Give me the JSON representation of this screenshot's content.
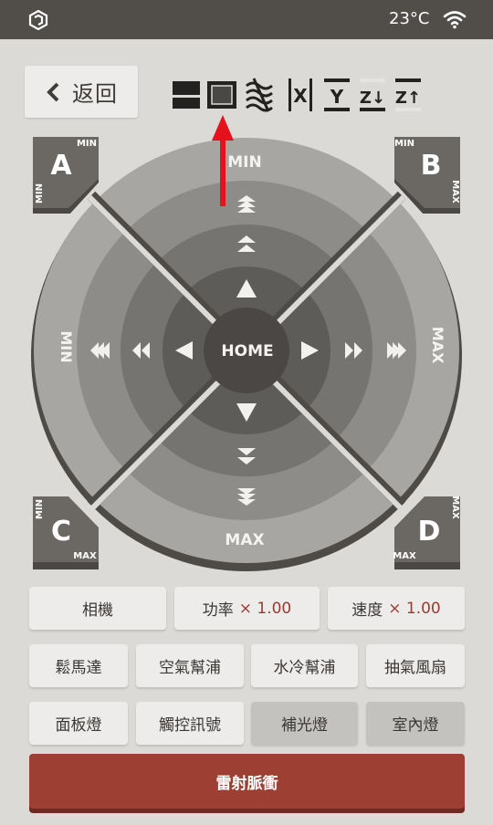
{
  "status_bar": {
    "temperature": "23°C",
    "logo_icon": "app-logo-icon",
    "wifi_icon": "wifi-icon"
  },
  "back_button": {
    "label": "返回",
    "icon": "chevron-left-icon"
  },
  "mode_icons": [
    {
      "name": "mode-fill-icon"
    },
    {
      "name": "mode-frame-icon",
      "selected": true
    },
    {
      "name": "mode-wave-icon"
    },
    {
      "name": "axis-x-icon",
      "label": "X"
    },
    {
      "name": "axis-y-icon",
      "label": "Y"
    },
    {
      "name": "axis-z-down-icon",
      "label": "Z↓"
    },
    {
      "name": "axis-z-up-icon",
      "label": "Z↑"
    }
  ],
  "jog_pad": {
    "home_label": "HOME",
    "top_label": "MIN",
    "bottom_label": "MAX",
    "left_label": "MIN",
    "right_label": "MAX"
  },
  "corners": {
    "a": {
      "label": "A",
      "min": "MIN",
      "max": "MIN"
    },
    "b": {
      "label": "B",
      "min": "MIN",
      "max": "MAX"
    },
    "c": {
      "label": "C",
      "min": "MIN",
      "max": "MAX"
    },
    "d": {
      "label": "D",
      "min": "MAX",
      "max": "MAX"
    }
  },
  "row1": {
    "camera": "相機",
    "power_label": "功率",
    "power_value": "× 1.00",
    "speed_label": "速度",
    "speed_value": "× 1.00"
  },
  "row2": [
    "鬆馬達",
    "空氣幫浦",
    "水冷幫浦",
    "抽氣風扇"
  ],
  "row3": [
    "面板燈",
    "觸控訊號",
    "補光燈",
    "室內燈"
  ],
  "laser_button": "雷射脈衝",
  "colors": {
    "accent": "#9d3f32",
    "status_bar": "#514e4a",
    "background": "#dcdad7"
  }
}
